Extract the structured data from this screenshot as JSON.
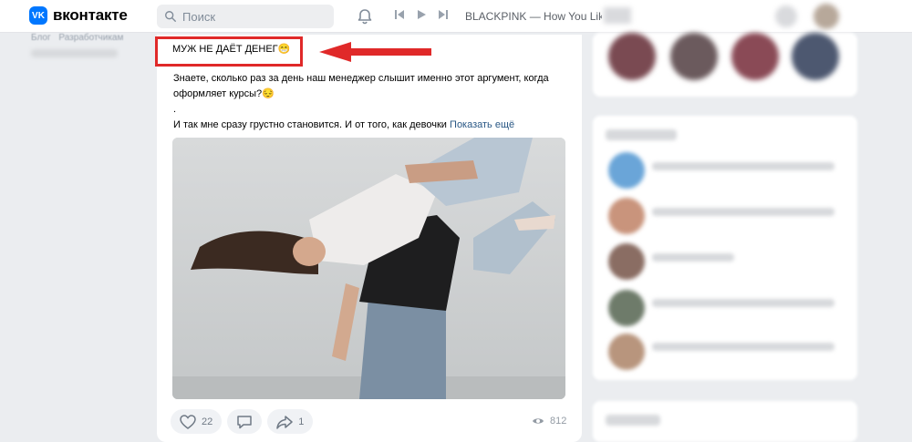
{
  "header": {
    "brand": "вконтакте",
    "brand_mark": "VK",
    "search_placeholder": "Поиск",
    "track": "BLACKPINK — How You Like That",
    "icons": [
      "search-icon",
      "bell-icon",
      "previous-icon",
      "play-icon",
      "next-icon"
    ]
  },
  "left_menu": {
    "links": [
      "Блог",
      "Разработчикам"
    ]
  },
  "post": {
    "title": "МУЖ НЕ ДАЁТ ДЕНЕГ😁",
    "text_line_1": "Знаете, сколько раз за день наш менеджер слышит именно этот аргумент, когда оформляет курсы?😔",
    "text_line_2": ".",
    "text_line_3": "И так мне сразу грустно становится. И от того, как девочки",
    "show_more": "Показать ещё",
    "likes": "22",
    "shares": "1",
    "views": "812",
    "highlight_color": "#e02929"
  },
  "colors": {
    "accent": "#0077ff",
    "link": "#2a5885"
  }
}
